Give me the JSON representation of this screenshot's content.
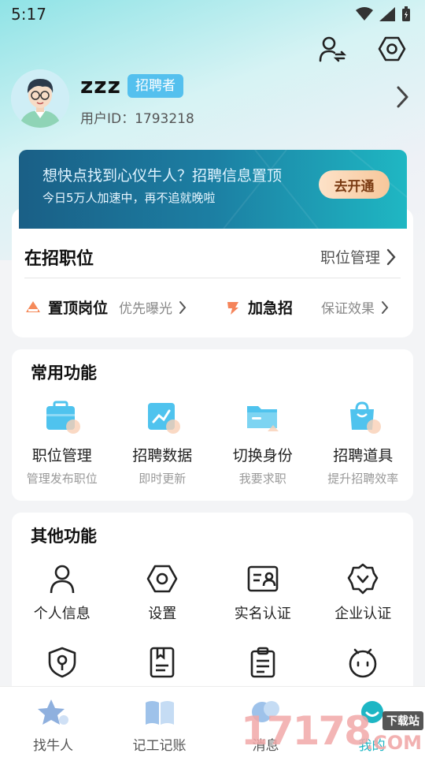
{
  "status_bar": {
    "time": "5:17"
  },
  "profile": {
    "username": "zzz",
    "role": "招聘者",
    "user_id_text": "用户ID：1793218"
  },
  "promo": {
    "title": "想快点找到心仪牛人？招聘信息置顶",
    "subtitle": "今日5万人加速中，再不追就晚啦",
    "button": "去开通"
  },
  "jobs": {
    "title": "在招职位",
    "manage_link": "职位管理",
    "pin": {
      "title": "置顶岗位",
      "sub": "优先曝光"
    },
    "urgent": {
      "title": "加急招",
      "sub": "保证效果"
    }
  },
  "common": {
    "heading": "常用功能",
    "items": [
      {
        "label": "职位管理",
        "sub": "管理发布职位",
        "icon": "briefcase-icon"
      },
      {
        "label": "招聘数据",
        "sub": "即时更新",
        "icon": "chart-icon"
      },
      {
        "label": "切换身份",
        "sub": "我要求职",
        "icon": "folder-icon"
      },
      {
        "label": "招聘道具",
        "sub": "提升招聘效率",
        "icon": "bag-icon"
      }
    ]
  },
  "other": {
    "heading": "其他功能",
    "items": [
      {
        "label": "个人信息",
        "icon": "person-icon"
      },
      {
        "label": "设置",
        "icon": "settings-icon"
      },
      {
        "label": "实名认证",
        "icon": "id-card-icon"
      },
      {
        "label": "企业认证",
        "icon": "badge-check-icon"
      },
      {
        "label": "",
        "icon": "shield-key-icon"
      },
      {
        "label": "",
        "icon": "notebook-icon"
      },
      {
        "label": "",
        "icon": "clipboard-icon"
      },
      {
        "label": "",
        "icon": "robot-icon"
      }
    ]
  },
  "tabs": [
    {
      "label": "找牛人",
      "icon": "star-icon"
    },
    {
      "label": "记工记账",
      "icon": "book-icon"
    },
    {
      "label": "消息",
      "icon": "chat-icon"
    },
    {
      "label": "我的",
      "icon": "smile-icon",
      "active": true
    }
  ],
  "watermark": {
    "number": "17178",
    "tag": "下载站",
    "suffix": ".COM"
  },
  "colors": {
    "accent": "#1db6c4",
    "badge": "#54c0ee",
    "promo_dark": "#1a5f86"
  }
}
